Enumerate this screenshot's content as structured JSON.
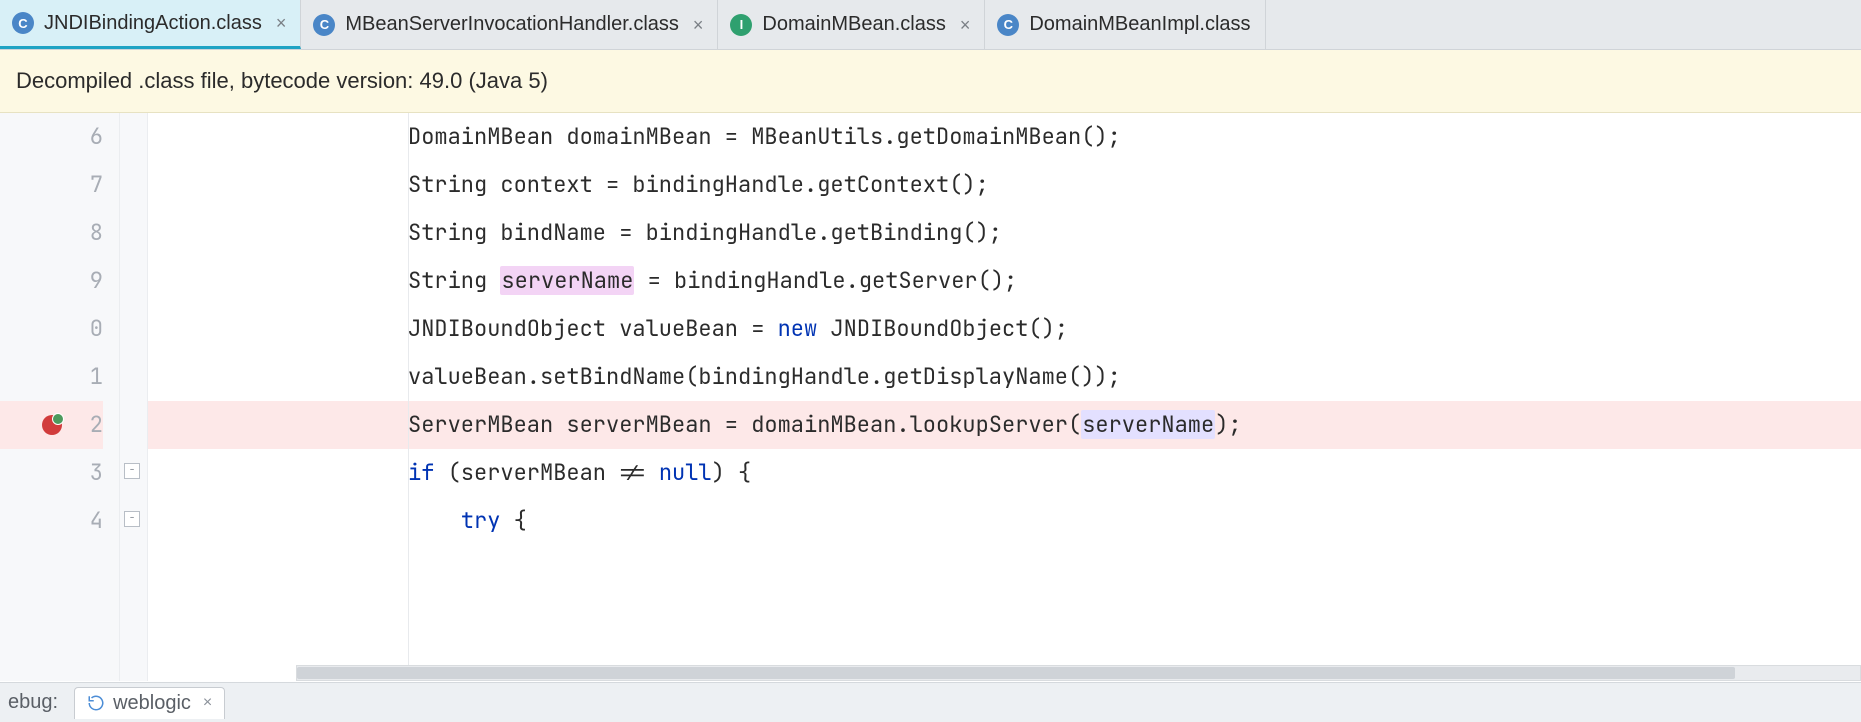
{
  "tabs": [
    {
      "label": "JNDIBindingAction.class",
      "icon_letter": "C",
      "icon_kind": "c",
      "active": true
    },
    {
      "label": "MBeanServerInvocationHandler.class",
      "icon_letter": "C",
      "icon_kind": "c",
      "active": false
    },
    {
      "label": "DomainMBean.class",
      "icon_letter": "I",
      "icon_kind": "i",
      "active": false
    },
    {
      "label": "DomainMBeanImpl.class",
      "icon_letter": "C",
      "icon_kind": "c",
      "active": false
    }
  ],
  "banner": {
    "text": "Decompiled .class file, bytecode version: 49.0 (Java 5)"
  },
  "editor": {
    "line_numbers": [
      "6",
      "7",
      "8",
      "9",
      "0",
      "1",
      "2",
      "3",
      "4"
    ],
    "breakpoint_line_index": 6,
    "highlighted_identifier": "serverName",
    "lines": [
      {
        "segments": [
          {
            "t": "DomainMBean domainMBean = MBeanUtils.getDomainMBean();"
          }
        ]
      },
      {
        "segments": [
          {
            "t": "String context = bindingHandle.getContext();"
          }
        ]
      },
      {
        "segments": [
          {
            "t": "String bindName = bindingHandle.getBinding();"
          }
        ]
      },
      {
        "segments": [
          {
            "t": "String "
          },
          {
            "t": "serverName",
            "cls": "hl-decl"
          },
          {
            "t": " = bindingHandle.getServer();"
          }
        ]
      },
      {
        "segments": [
          {
            "t": "JNDIBoundObject valueBean = "
          },
          {
            "t": "new",
            "cls": "kw"
          },
          {
            "t": " JNDIBoundObject();"
          }
        ]
      },
      {
        "segments": [
          {
            "t": "valueBean.setBindName(bindingHandle.getDisplayName());"
          }
        ]
      },
      {
        "segments": [
          {
            "t": "ServerMBean serverMBean = domainMBean.lookupServer("
          },
          {
            "t": "serverName",
            "cls": "hl-use"
          },
          {
            "t": ");"
          }
        ],
        "bp": true
      },
      {
        "segments": [
          {
            "t": "if",
            "cls": "kw"
          },
          {
            "t": " (serverMBean != "
          },
          {
            "t": "null",
            "cls": "kw"
          },
          {
            "t": ") {"
          }
        ]
      },
      {
        "segments": [
          {
            "t": "    "
          },
          {
            "t": "try",
            "cls": "kw"
          },
          {
            "t": " {"
          }
        ]
      }
    ]
  },
  "bottom": {
    "label_left": "ebug:",
    "run_config": "weblogic"
  }
}
